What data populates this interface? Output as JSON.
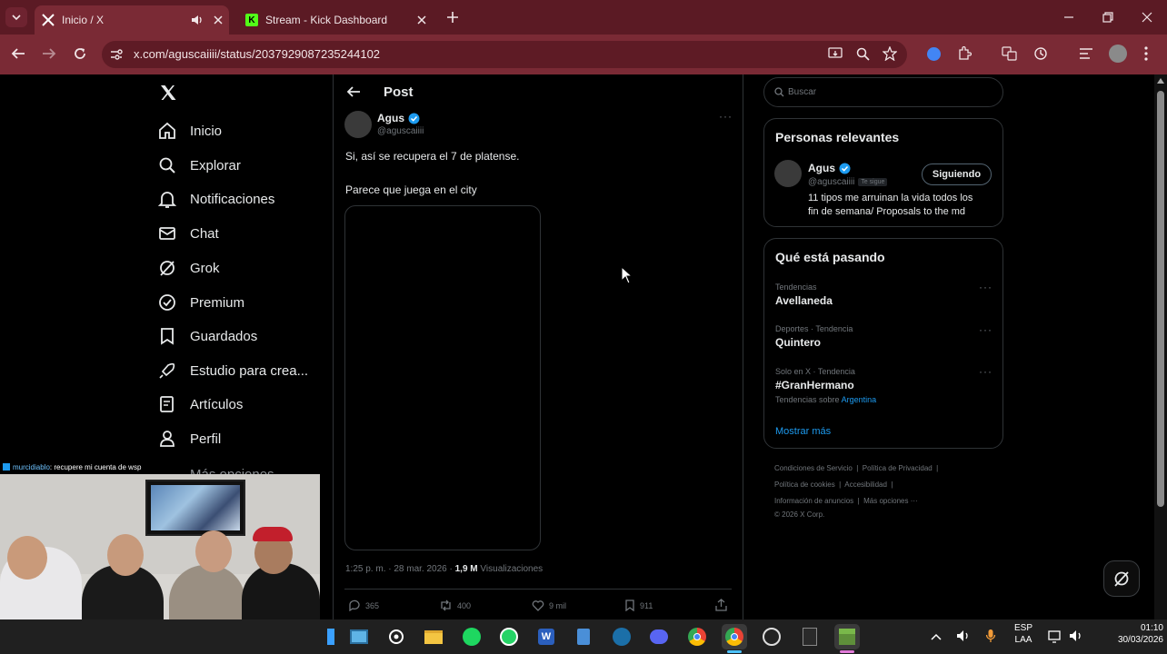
{
  "browser": {
    "tabs": [
      {
        "title": "Inicio / X",
        "active": true
      },
      {
        "title": "Stream - Kick Dashboard",
        "active": false
      }
    ],
    "url": "x.com/aguscaiiii/status/2037929087235244102"
  },
  "sidebar": {
    "items": [
      {
        "label": "Inicio",
        "icon": "home-icon"
      },
      {
        "label": "Explorar",
        "icon": "search-icon"
      },
      {
        "label": "Notificaciones",
        "icon": "bell-icon"
      },
      {
        "label": "Chat",
        "icon": "mail-icon"
      },
      {
        "label": "Grok",
        "icon": "grok-icon"
      },
      {
        "label": "Premium",
        "icon": "premium-icon"
      },
      {
        "label": "Guardados",
        "icon": "bookmark-icon"
      },
      {
        "label": "Estudio para crea...",
        "icon": "rocket-icon"
      },
      {
        "label": "Artículos",
        "icon": "article-icon"
      },
      {
        "label": "Perfil",
        "icon": "person-icon"
      }
    ],
    "more": "Más opciones"
  },
  "post": {
    "header": "Post",
    "author_name": "Agus",
    "author_handle": "@aguscaiiii",
    "text_line1": "Si, así se recupera el 7 de platense.",
    "text_line2": "Parece que juega en el city",
    "time": "1:25 p. m. · 28 mar. 2026 · ",
    "views_count": "1,9 M",
    "views_label": "Visualizaciones",
    "replies": "365",
    "reposts": "400",
    "likes": "9 mil",
    "bookmarks": "911"
  },
  "search": {
    "placeholder": "Buscar"
  },
  "relevant": {
    "title": "Personas relevantes",
    "name": "Agus",
    "handle": "@aguscaiiii",
    "follows_you": "Te sigue",
    "button": "Siguiendo",
    "bio_line1": "11 tipos me arruinan la vida todos los",
    "bio_line2": "fin de semana/ Proposals to the md"
  },
  "trends": {
    "title": "Qué está pasando",
    "items": [
      {
        "meta": "Tendencias",
        "name": "Avellaneda"
      },
      {
        "meta": "Deportes · Tendencia",
        "name": "Quintero"
      },
      {
        "meta": "Solo en X · Tendencia",
        "name": "#GranHermano",
        "sub_prefix": "Tendencias sobre",
        "sub_link": "Argentina"
      }
    ],
    "show_more": "Mostrar más"
  },
  "footer": {
    "links": [
      "Condiciones de Servicio",
      "Política de Privacidad",
      "Política de cookies",
      "Accesibilidad",
      "Información de anuncios",
      "Más opciones ···"
    ],
    "copyright": "© 2026 X Corp."
  },
  "stream_chat": {
    "user": "murcidiablo",
    "message": ": recupere mi cuenta de wsp"
  },
  "taskbar": {
    "lang1": "ESP",
    "lang2": "LAA",
    "time": "01:10",
    "date": "30/03/2026"
  },
  "colors": {
    "tab_strip": "#5b1a24",
    "toolbar": "#7a2a35",
    "x_blue": "#1d9bf0",
    "border": "#2f3336"
  }
}
